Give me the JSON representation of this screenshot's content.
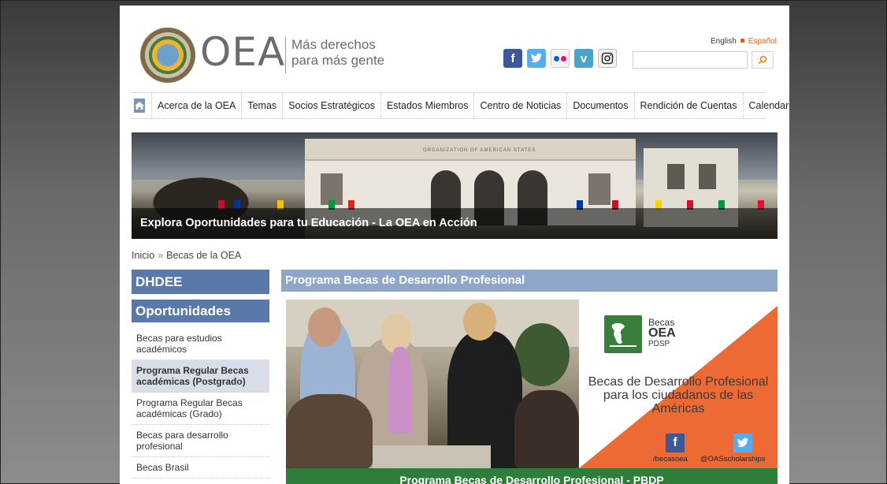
{
  "header": {
    "logo_text": "OEA",
    "tagline_line1": "Más derechos",
    "tagline_line2": "para más gente",
    "lang_english": "English",
    "lang_spanish": "Español",
    "social": [
      {
        "name": "facebook",
        "glyph": "f",
        "color": "#3b5998"
      },
      {
        "name": "twitter",
        "glyph": "t",
        "color": "#55acee"
      },
      {
        "name": "flickr",
        "glyph": "••",
        "color": "#f2f2f2"
      },
      {
        "name": "vimeo",
        "glyph": "v",
        "color": "#4aa3c8"
      },
      {
        "name": "instagram",
        "glyph": "◎",
        "color": "#eaeaea"
      }
    ],
    "search_placeholder": ""
  },
  "nav": {
    "items": [
      "Acerca de la OEA",
      "Temas",
      "Socios Estratégicos",
      "Estados Miembros",
      "Centro de Noticias",
      "Documentos",
      "Rendición de Cuentas",
      "Calendario"
    ]
  },
  "hero": {
    "caption": "Explora Oportunidades para tu Educación - La OEA en Acción",
    "building_inscription": "ORGANIZATION OF AMERICAN STATES"
  },
  "breadcrumb": {
    "home": "Inicio",
    "separator": "»",
    "current": "Becas de la OEA"
  },
  "sidebar": {
    "heading1": "DHDEE",
    "heading2": "Oportunidades",
    "links": [
      {
        "label": "Becas para estudios académicos",
        "active": false
      },
      {
        "label": "Programa Regular Becas académicas (Postgrado)",
        "active": true
      },
      {
        "label": "Programa Regular Becas académicas (Grado)",
        "active": false
      },
      {
        "label": "Becas para desarrollo profesional",
        "active": false
      },
      {
        "label": "Becas Brasil",
        "active": false
      }
    ]
  },
  "main": {
    "title": "Programa Becas de Desarrollo Profesional",
    "promo": {
      "logo_line1": "Becas",
      "logo_line2": "OEA",
      "logo_line3": "PDSP",
      "text": "Becas de Desarrollo Profesional para los ciudadanos de las Américas",
      "facebook_handle": "/becasoea",
      "twitter_handle": "@OASscholarships"
    },
    "bottom_bar": "Programa Becas de Desarrollo Profesional - PBDP"
  }
}
